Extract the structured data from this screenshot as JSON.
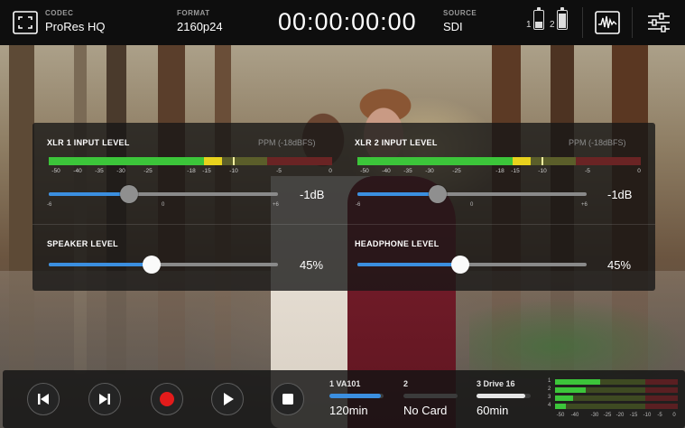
{
  "topbar": {
    "codec_label": "CODEC",
    "codec_value": "ProRes HQ",
    "format_label": "FORMAT",
    "format_value": "2160p24",
    "timecode": "00:00:00:00",
    "source_label": "SOURCE",
    "source_value": "SDI",
    "battery1_label": "1",
    "battery1_level": 0.35,
    "battery2_label": "2",
    "battery2_level": 0.8
  },
  "audio_panel": {
    "xlr1": {
      "title": "XLR 1 INPUT LEVEL",
      "ppm_label": "PPM (-18dBFS)",
      "scale": [
        "-50",
        "-40",
        "-35",
        "-30",
        "-25",
        "-18",
        "-15",
        "-10",
        "-5",
        "0"
      ],
      "gain_value": "-1dB",
      "gain_fraction": 0.35,
      "min_label": "-6",
      "mid_label": "0",
      "max_label": "+6"
    },
    "xlr2": {
      "title": "XLR 2 INPUT LEVEL",
      "ppm_label": "PPM (-18dBFS)",
      "scale": [
        "-50",
        "-40",
        "-35",
        "-30",
        "-25",
        "-18",
        "-15",
        "-10",
        "-5",
        "0"
      ],
      "gain_value": "-1dB",
      "gain_fraction": 0.35,
      "min_label": "-6",
      "mid_label": "0",
      "max_label": "+6"
    },
    "speaker": {
      "title": "SPEAKER LEVEL",
      "value": "45%",
      "fraction": 0.45
    },
    "headphone": {
      "title": "HEADPHONE LEVEL",
      "value": "45%",
      "fraction": 0.45
    }
  },
  "transport": {
    "buttons": [
      "previous-clip",
      "next-clip",
      "record",
      "play",
      "stop"
    ]
  },
  "media": {
    "slot1": {
      "head": "1  VA101",
      "value": "120min",
      "fill": 0.95,
      "color": "#3b8fe0"
    },
    "slot2": {
      "head": "2",
      "value": "No Card",
      "fill": 0,
      "color": "#3b3b3b"
    },
    "slot3": {
      "head": "3  Drive 16",
      "value": "60min",
      "fill": 0.9,
      "color": "#e6e6e6"
    }
  },
  "mini_meters": {
    "channels": [
      "1",
      "2",
      "3",
      "4"
    ],
    "scale": [
      "-50",
      "-40",
      "-30",
      "-25",
      "-20",
      "-15",
      "-10",
      "-5",
      "0"
    ]
  },
  "colors": {
    "accent_blue": "#3b8fe0",
    "record_red": "#e31b1b",
    "meter_green": "#3cc53a",
    "meter_yellow": "#e8d21d"
  }
}
